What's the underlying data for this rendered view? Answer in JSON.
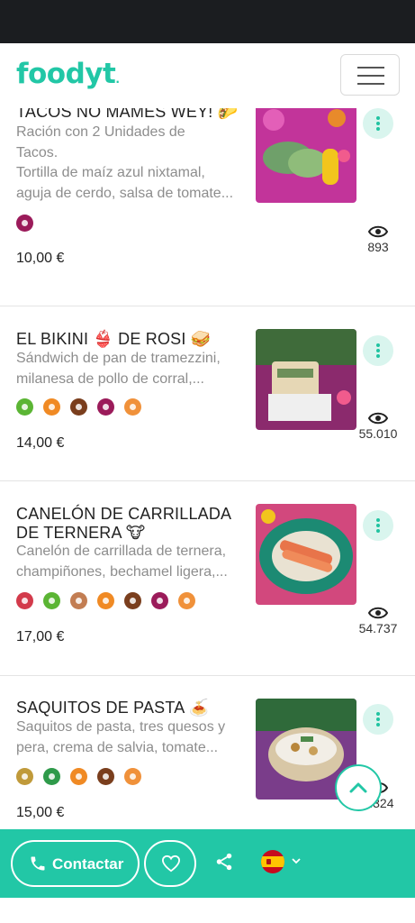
{
  "brand": {
    "logo_text": "foodyt",
    "logo_dot": "."
  },
  "colors": {
    "accent": "#22c7a6",
    "status_bar": "#1b1d20"
  },
  "menu_icon": "hamburger-icon",
  "dishes": [
    {
      "title": "TACOS NO MAMÉS WEY! 🌮",
      "desc1": "Ración con 2 Unidades de",
      "desc2": "Tacos.",
      "desc3": "Tortilla de maíz azul nixtamal,",
      "desc4": "aguja de cerdo, salsa de tomate...",
      "price": "10,00 €",
      "views": "893",
      "allergens": [
        "sulfites-icon"
      ]
    },
    {
      "title": "EL BIKINI 👙 DE ROSI 🥪",
      "desc1": "Sándwich de pan de tramezzini,",
      "desc2": "milanesa de pollo de corral,...",
      "price": "14,00 €",
      "views": "55.010",
      "allergens": [
        "celery-icon",
        "eggs-icon",
        "soy-icon",
        "sulfites-icon",
        "gluten-icon"
      ]
    },
    {
      "title": "CANELÓN DE CARRILLADA",
      "title2": "DE TERNERA 🐮",
      "desc1": "Canelón de carrillada de ternera,",
      "desc2": "champiñones, bechamel ligera,...",
      "price": "17,00 €",
      "views": "54.737",
      "allergens": [
        "nuts-icon",
        "celery-icon",
        "peanuts-icon",
        "eggs-icon",
        "soy-icon",
        "sulfites-icon",
        "gluten-icon"
      ]
    },
    {
      "title": "SAQUITOS DE PASTA 🍝",
      "desc1": "Saquitos de pasta, tres quesos y",
      "desc2": "pera, crema de salvia, tomate...",
      "price": "15,00 €",
      "views": "5.324",
      "allergens": [
        "milk-icon",
        "mustard-icon",
        "eggs-icon",
        "soy-icon",
        "gluten-icon"
      ]
    }
  ],
  "bottom_bar": {
    "contact_label": "Contactar",
    "language": "ES"
  }
}
